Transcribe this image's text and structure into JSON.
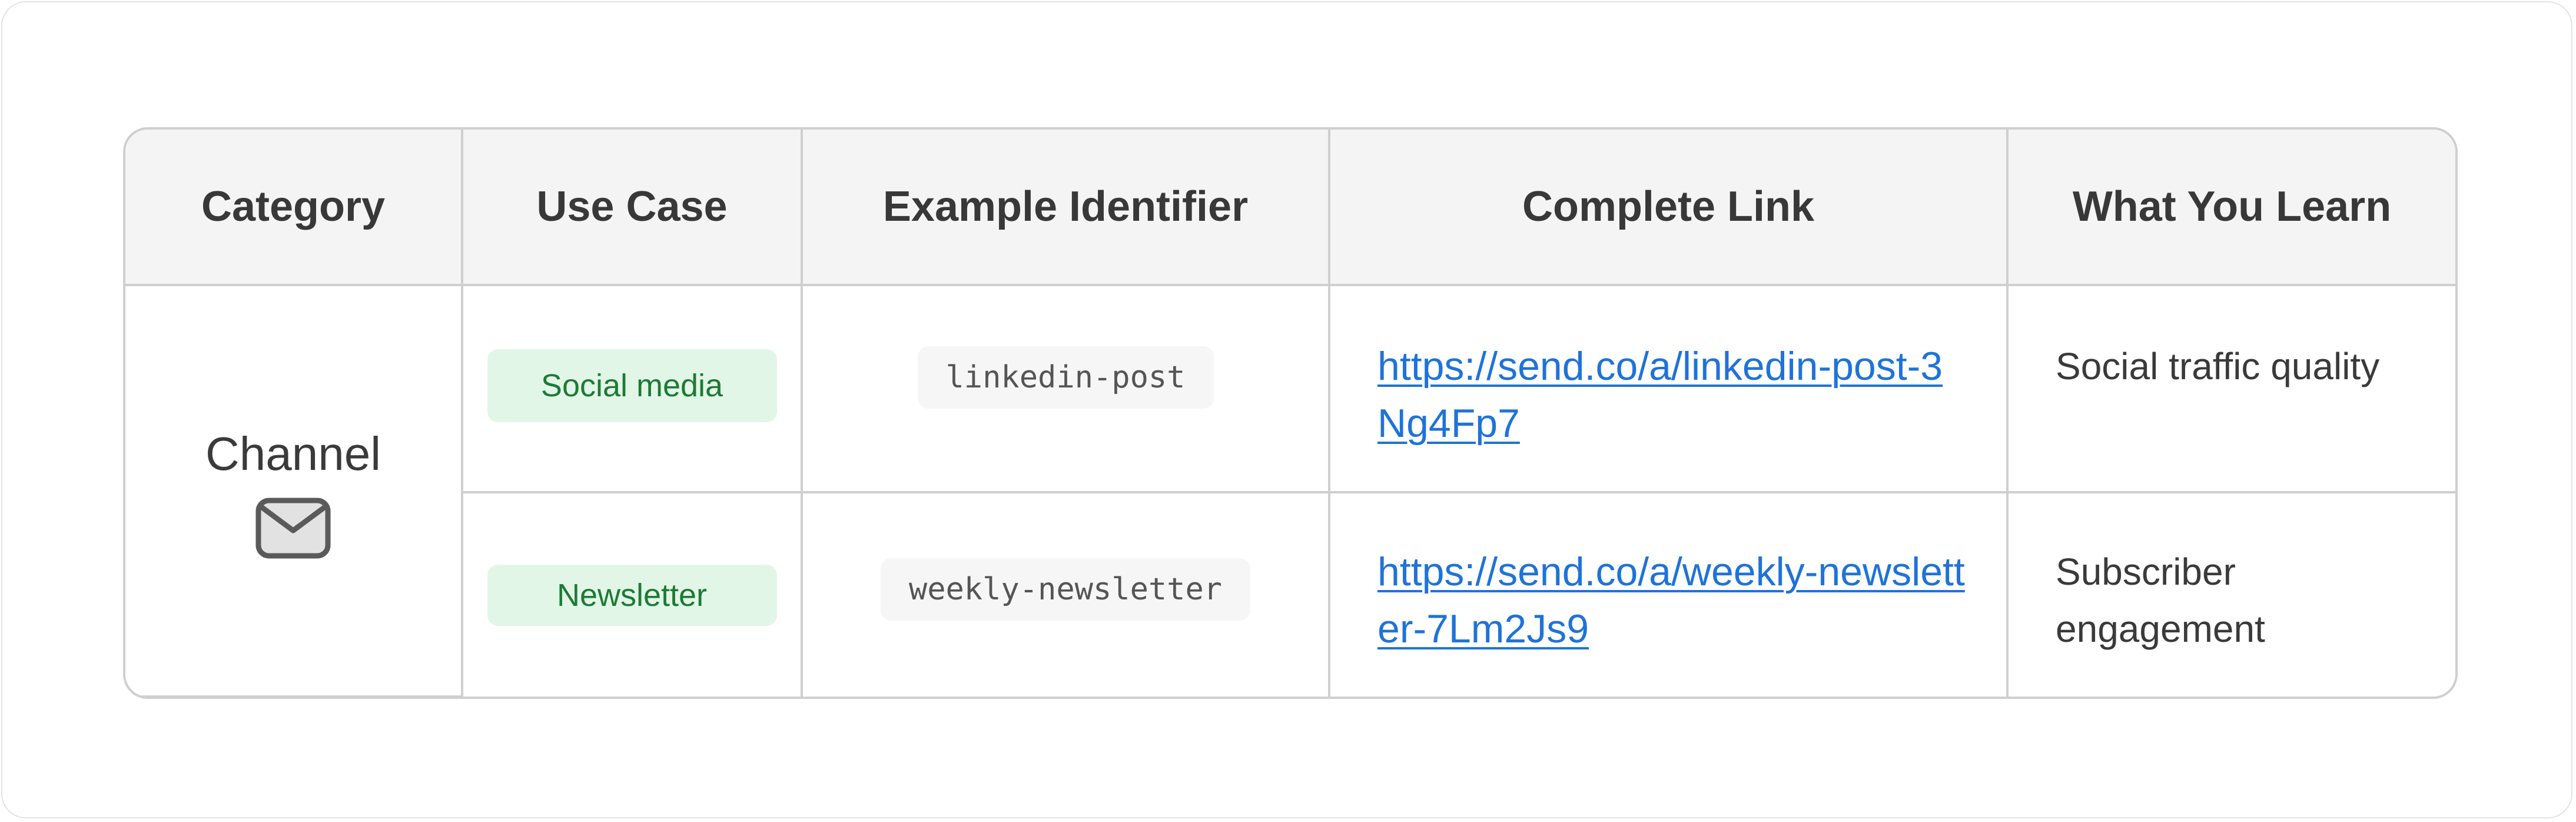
{
  "table": {
    "headers": [
      "Category",
      "Use Case",
      "Example Identifier",
      "Complete Link",
      "What You Learn"
    ],
    "category": {
      "label": "Channel",
      "icon": "envelope-icon"
    },
    "rows": [
      {
        "use_case": "Social media",
        "identifier": "linkedin-post",
        "link": "https://send.co/a/linkedin-post-3Ng4Fp7",
        "learn": "Social traffic quality"
      },
      {
        "use_case": "Newsletter",
        "identifier": "weekly-newsletter",
        "link": "https://send.co/a/weekly-newsletter-7Lm2Js9",
        "learn": "Subscriber engagement"
      }
    ]
  },
  "colors": {
    "badge_bg": "#e2f6e7",
    "badge_text": "#1d7a35",
    "link": "#1f73d8",
    "header_bg": "#f4f4f4",
    "border": "#cfcfcf"
  }
}
